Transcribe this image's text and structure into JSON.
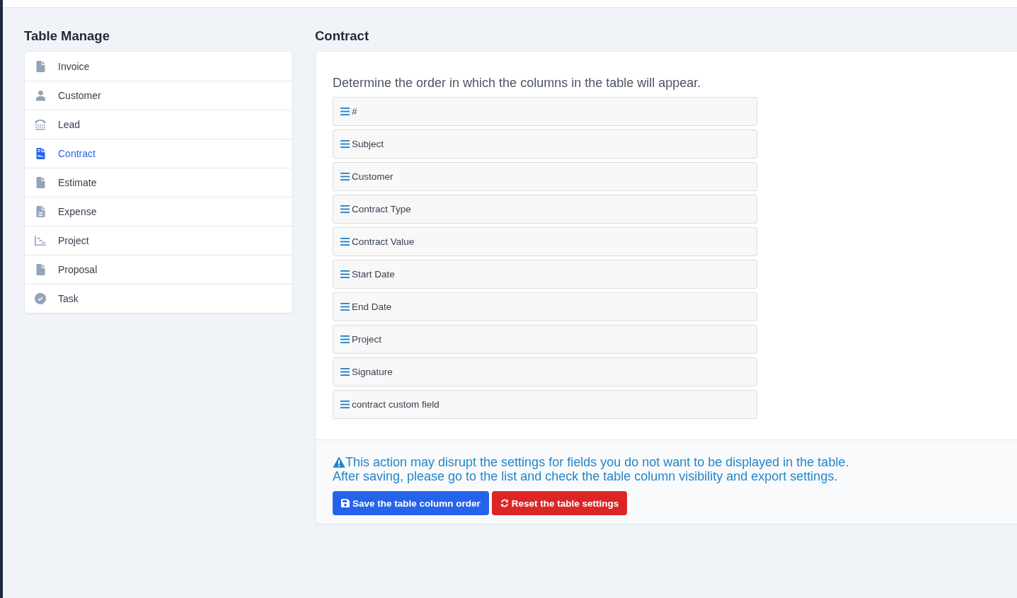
{
  "sidebar": {
    "title": "Table Manage",
    "items": [
      {
        "label": "Invoice",
        "selected": false
      },
      {
        "label": "Customer",
        "selected": false
      },
      {
        "label": "Lead",
        "selected": false
      },
      {
        "label": "Contract",
        "selected": true
      },
      {
        "label": "Estimate",
        "selected": false
      },
      {
        "label": "Expense",
        "selected": false
      },
      {
        "label": "Project",
        "selected": false
      },
      {
        "label": "Proposal",
        "selected": false
      },
      {
        "label": "Task",
        "selected": false
      }
    ]
  },
  "panel": {
    "title": "Contract",
    "description": "Determine the order in which the columns in the table will appear.",
    "columns": [
      "#",
      "Subject",
      "Customer",
      "Contract Type",
      "Contract Value",
      "Start Date",
      "End Date",
      "Project",
      "Signature",
      "contract custom field"
    ],
    "warning": [
      "This action may disrupt the settings for fields you do not want to be displayed in the table.",
      "After saving, please go to the list and check the table column visibility and export settings."
    ],
    "buttons": [
      {
        "label": "Save the table column order",
        "kind": "save"
      },
      {
        "label": "Reset the table settings",
        "kind": "reset"
      }
    ]
  }
}
